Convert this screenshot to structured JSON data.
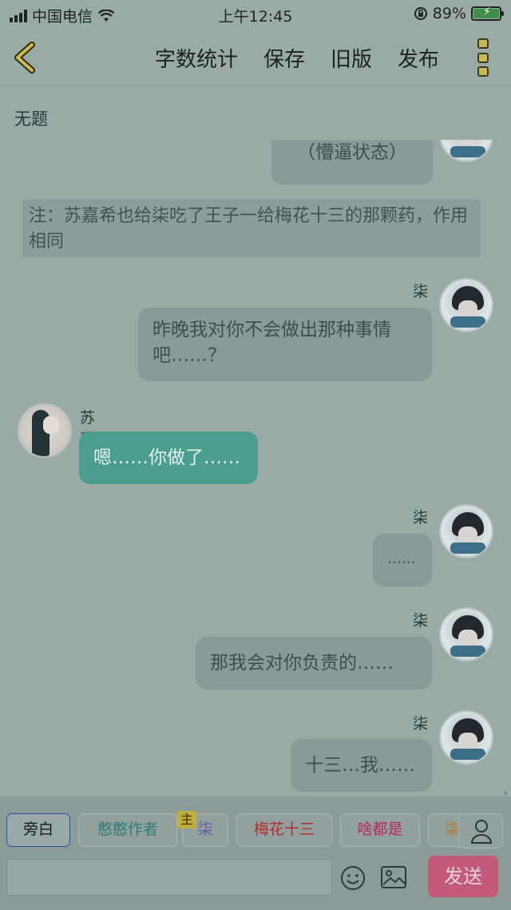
{
  "status": {
    "carrier": "中国电信",
    "time": "上午12:45",
    "battery": "89%"
  },
  "nav": {
    "word_count": "字数统计",
    "save": "保存",
    "old_version": "旧版",
    "publish": "发布"
  },
  "title": "无题",
  "messages": {
    "m0": "（懵逼状态）",
    "note": "注：苏嘉希也给柒吃了王子一给梅花十三的那颗药，作用相同",
    "m1_name": "柒",
    "m1": "昨晚我对你不会做出那种事情吧……？",
    "m2_name": "苏嘉希",
    "m2": "嗯……你做了……",
    "m3_name": "柒",
    "m3": "……",
    "m4_name": "柒",
    "m4": "那我会对你负责的……",
    "m5_name": "柒",
    "m5": "十三…我……"
  },
  "roles": [
    {
      "label": "旁白",
      "color": "#1d2725"
    },
    {
      "label": "憨憨作者",
      "color": "#2e7d74"
    },
    {
      "label": "柒",
      "color": "#6a56a8"
    },
    {
      "label": "梅花十三",
      "color": "#b52b2b"
    },
    {
      "label": "啥都是",
      "color": "#b4285e"
    },
    {
      "label": "柒",
      "color": "#b47a35"
    }
  ],
  "role_tag": "主",
  "input": {
    "placeholder": ""
  },
  "send": "发送"
}
